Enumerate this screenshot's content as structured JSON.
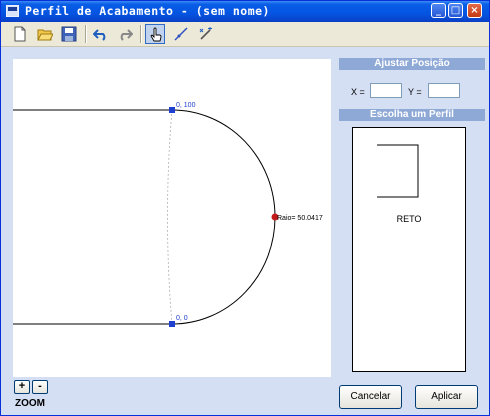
{
  "window": {
    "title": "Perfil de Acabamento - (sem nome)"
  },
  "toolbar": {
    "items": [
      "new-document",
      "open-folder",
      "save",
      "undo",
      "redo",
      "pointer-hand",
      "draw-line",
      "magic-wand"
    ],
    "active": "pointer-hand"
  },
  "canvas": {
    "point_top_label": "0, 100",
    "point_bottom_label": "0, 0",
    "radius_label": "Raio= 50.0417"
  },
  "position_panel": {
    "header": "Ajustar Posição",
    "x_label": "X =",
    "y_label": "Y =",
    "x_value": "",
    "y_value": ""
  },
  "profile_panel": {
    "header": "Escolha um Perfil",
    "selected_profile": "RETO"
  },
  "buttons": {
    "cancel": "Cancelar",
    "apply": "Aplicar"
  },
  "zoom": {
    "plus": "+",
    "minus": "-",
    "label": "ZOOM"
  }
}
